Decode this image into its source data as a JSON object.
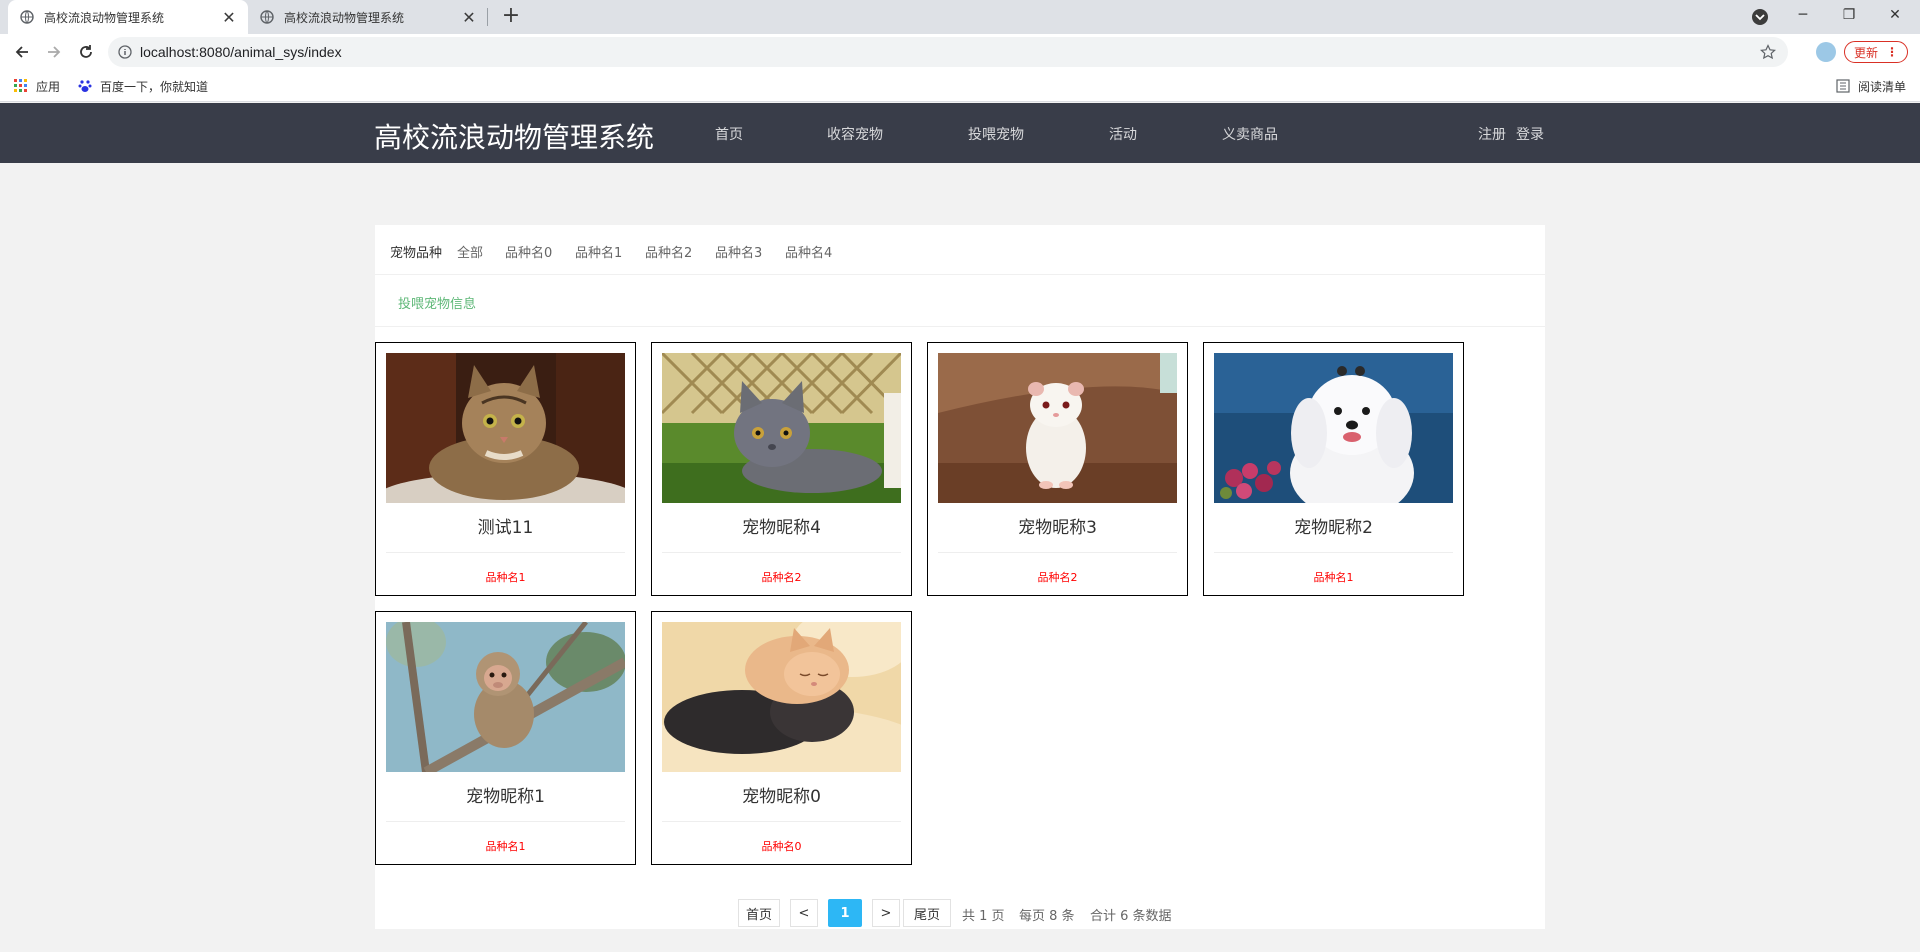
{
  "browser": {
    "tabs": [
      {
        "title": "高校流浪动物管理系统"
      },
      {
        "title": "高校流浪动物管理系统"
      }
    ],
    "address": "localhost:8080/animal_sys/index",
    "update_label": "更新",
    "bookmarks": {
      "apps": "应用",
      "baidu": "百度一下，你就知道",
      "reading_list": "阅读清单"
    }
  },
  "header": {
    "logo": "高校流浪动物管理系统",
    "nav": [
      "首页",
      "收容宠物",
      "投喂宠物",
      "活动",
      "义卖商品"
    ],
    "register": "注册",
    "login": "登录"
  },
  "filter": {
    "label": "宠物品种",
    "options": [
      "全部",
      "品种名0",
      "品种名1",
      "品种名2",
      "品种名3",
      "品种名4"
    ]
  },
  "section_title": "投喂宠物信息",
  "pets": [
    {
      "name": "测试11",
      "breed": "品种名1",
      "photo": "tabby-cat"
    },
    {
      "name": "宠物昵称4",
      "breed": "品种名2",
      "photo": "grey-cat"
    },
    {
      "name": "宠物昵称3",
      "breed": "品种名2",
      "photo": "hamster"
    },
    {
      "name": "宠物昵称2",
      "breed": "品种名1",
      "photo": "white-dog"
    },
    {
      "name": "宠物昵称1",
      "breed": "品种名1",
      "photo": "monkey"
    },
    {
      "name": "宠物昵称0",
      "breed": "品种名0",
      "photo": "sleeping-kittens"
    }
  ],
  "pagination": {
    "first": "首页",
    "prev": "<",
    "current": "1",
    "next": ">",
    "last": "尾页",
    "total_pages": "共 1 页",
    "per_page": "每页 8 条",
    "total_items": "合计 6 条数据"
  }
}
